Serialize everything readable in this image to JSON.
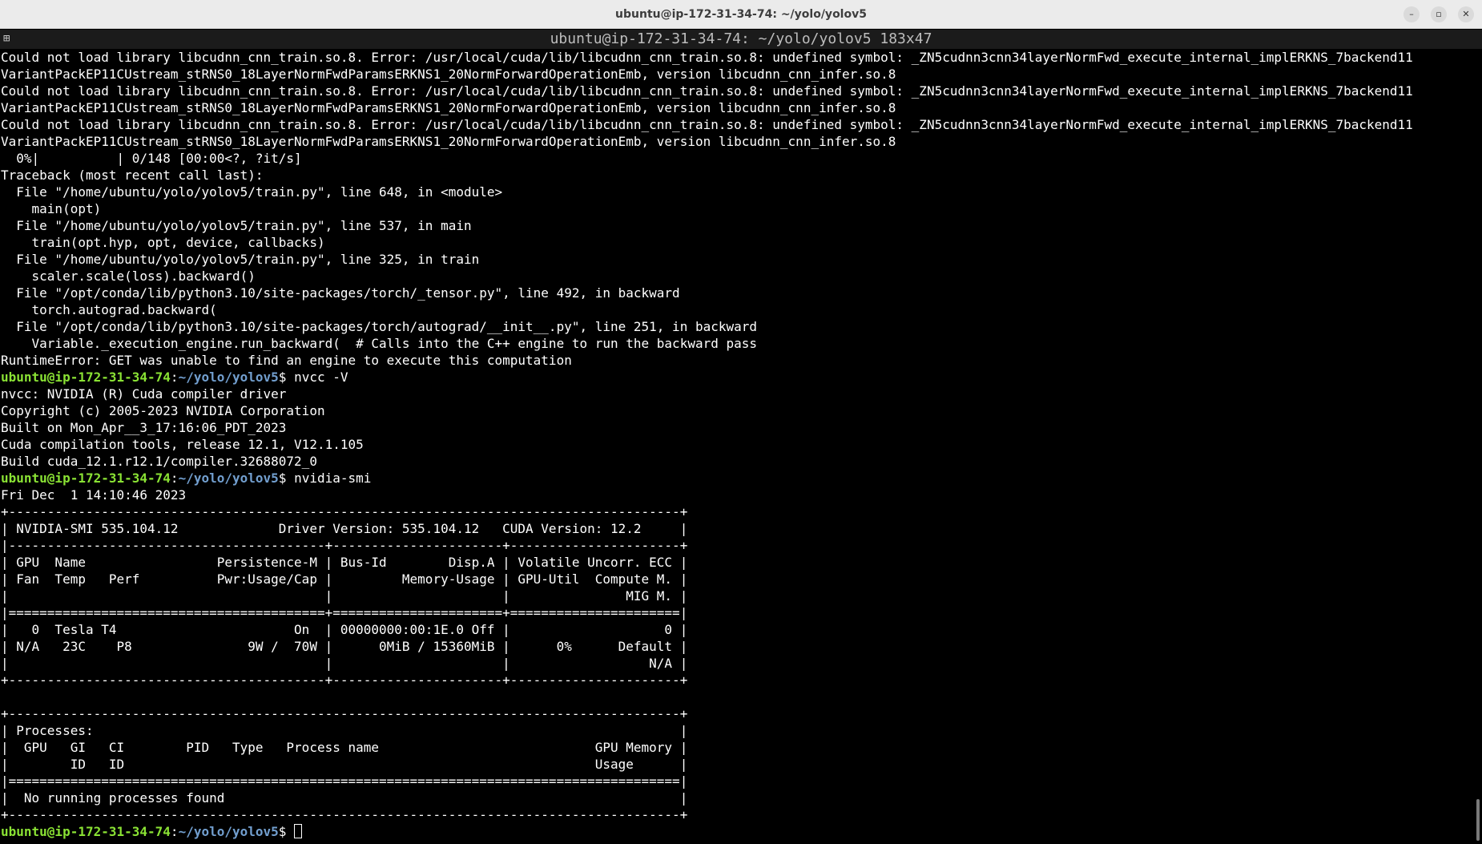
{
  "window": {
    "title": "ubuntu@ip-172-31-34-74: ~/yolo/yolov5",
    "minimize_glyph": "–",
    "maximize_glyph": "▫",
    "close_glyph": "✕"
  },
  "tmux": {
    "icon": "⊞",
    "title": "ubuntu@ip-172-31-34-74: ~/yolo/yolov5 183x47"
  },
  "terminal": {
    "lines": [
      "Could not load library libcudnn_cnn_train.so.8. Error: /usr/local/cuda/lib/libcudnn_cnn_train.so.8: undefined symbol: _ZN5cudnn3cnn34layerNormFwd_execute_internal_implERKNS_7backend11",
      "VariantPackEP11CUstream_stRNS0_18LayerNormFwdParamsERKNS1_20NormForwardOperationEmb, version libcudnn_cnn_infer.so.8",
      "Could not load library libcudnn_cnn_train.so.8. Error: /usr/local/cuda/lib/libcudnn_cnn_train.so.8: undefined symbol: _ZN5cudnn3cnn34layerNormFwd_execute_internal_implERKNS_7backend11",
      "VariantPackEP11CUstream_stRNS0_18LayerNormFwdParamsERKNS1_20NormForwardOperationEmb, version libcudnn_cnn_infer.so.8",
      "Could not load library libcudnn_cnn_train.so.8. Error: /usr/local/cuda/lib/libcudnn_cnn_train.so.8: undefined symbol: _ZN5cudnn3cnn34layerNormFwd_execute_internal_implERKNS_7backend11",
      "VariantPackEP11CUstream_stRNS0_18LayerNormFwdParamsERKNS1_20NormForwardOperationEmb, version libcudnn_cnn_infer.so.8",
      "  0%|          | 0/148 [00:00<?, ?it/s]",
      "Traceback (most recent call last):",
      "  File \"/home/ubuntu/yolo/yolov5/train.py\", line 648, in <module>",
      "    main(opt)",
      "  File \"/home/ubuntu/yolo/yolov5/train.py\", line 537, in main",
      "    train(opt.hyp, opt, device, callbacks)",
      "  File \"/home/ubuntu/yolo/yolov5/train.py\", line 325, in train",
      "    scaler.scale(loss).backward()",
      "  File \"/opt/conda/lib/python3.10/site-packages/torch/_tensor.py\", line 492, in backward",
      "    torch.autograd.backward(",
      "  File \"/opt/conda/lib/python3.10/site-packages/torch/autograd/__init__.py\", line 251, in backward",
      "    Variable._execution_engine.run_backward(  # Calls into the C++ engine to run the backward pass",
      "RuntimeError: GET was unable to find an engine to execute this computation",
      "",
      "nvcc: NVIDIA (R) Cuda compiler driver",
      "Copyright (c) 2005-2023 NVIDIA Corporation",
      "Built on Mon_Apr__3_17:16:06_PDT_2023",
      "Cuda compilation tools, release 12.1, V12.1.105",
      "Build cuda_12.1.r12.1/compiler.32688072_0",
      "",
      "Fri Dec  1 14:10:46 2023",
      "+---------------------------------------------------------------------------------------+",
      "| NVIDIA-SMI 535.104.12             Driver Version: 535.104.12   CUDA Version: 12.2     |",
      "|-----------------------------------------+----------------------+----------------------+",
      "| GPU  Name                 Persistence-M | Bus-Id        Disp.A | Volatile Uncorr. ECC |",
      "| Fan  Temp   Perf          Pwr:Usage/Cap |         Memory-Usage | GPU-Util  Compute M. |",
      "|                                         |                      |               MIG M. |",
      "|=========================================+======================+======================|",
      "|   0  Tesla T4                       On  | 00000000:00:1E.0 Off |                    0 |",
      "| N/A   23C    P8               9W /  70W |      0MiB / 15360MiB |      0%      Default |",
      "|                                         |                      |                  N/A |",
      "+-----------------------------------------+----------------------+----------------------+",
      "",
      "+---------------------------------------------------------------------------------------+",
      "| Processes:                                                                            |",
      "|  GPU   GI   CI        PID   Type   Process name                            GPU Memory |",
      "|        ID   ID                                                             Usage      |",
      "|=======================================================================================|",
      "|  No running processes found                                                           |",
      "+---------------------------------------------------------------------------------------+",
      ""
    ],
    "prompt_user": "ubuntu@ip-172-31-34-74",
    "prompt_sep": ":",
    "prompt_path": "~/yolo/yolov5",
    "prompt_dollar": "$ ",
    "commands": {
      "nvcc": "nvcc -V",
      "smi": "nvidia-smi",
      "current": ""
    }
  }
}
